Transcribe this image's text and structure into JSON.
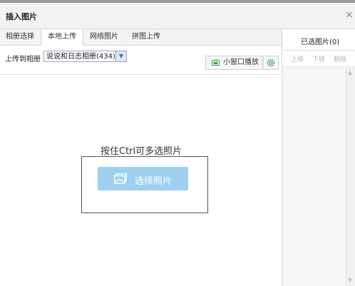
{
  "dialog": {
    "title": "插入图片",
    "close_symbol": "×"
  },
  "tabs": [
    {
      "label": "相册选择",
      "active": false
    },
    {
      "label": "本地上传",
      "active": true
    },
    {
      "label": "网络图片",
      "active": false
    },
    {
      "label": "拼图上传",
      "active": false
    }
  ],
  "upload": {
    "label": "上传到相册",
    "album_selected": "说说和日志相册(434)",
    "dropdown_arrow": "▼"
  },
  "toolbar": {
    "small_window_label": "小窗口播放",
    "small_window_icon": "tv-icon",
    "settings_icon": "gear-icon"
  },
  "drop_zone": {
    "hint": "按住Ctrl可多选照片",
    "choose_button_label": "选择照片",
    "choose_icon": "picture-icon"
  },
  "right_panel": {
    "title": "已选图片(0)",
    "actions": [
      "上移",
      "下移",
      "删除"
    ]
  },
  "colors": {
    "choose_button": "#9fd0f0",
    "icon_green": "#3aa655",
    "panel_bg": "#f6f6f6"
  }
}
